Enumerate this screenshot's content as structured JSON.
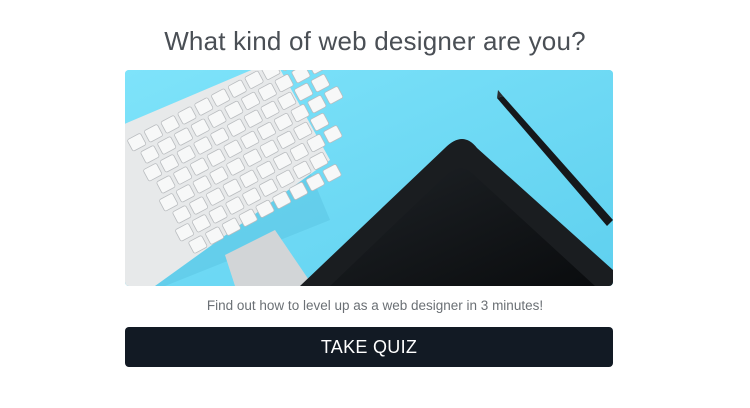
{
  "quiz": {
    "title": "What kind of web designer are you?",
    "subtitle": "Find out how to level up as a web designer in 3 minutes!",
    "cta_label": "TAKE QUIZ",
    "hero_image": "keyboard-tablet-stylus-photo"
  },
  "colors": {
    "hero_background": "#6fd9f5",
    "button_background": "#121a24",
    "button_text": "#ffffff",
    "title_text": "#4a4f55"
  }
}
